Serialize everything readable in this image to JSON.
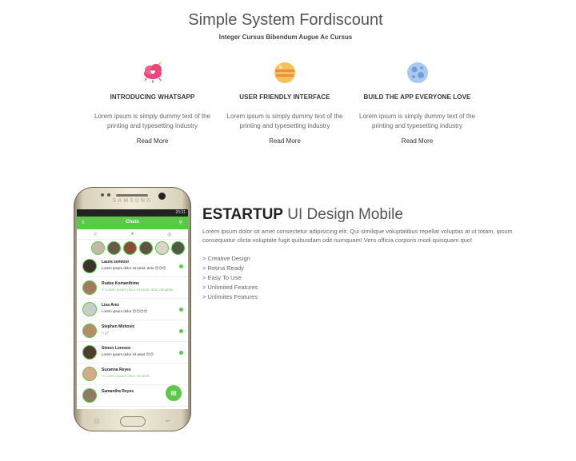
{
  "header": {
    "title": "Simple System Fordiscount",
    "subtitle": "Integer Cursus Bibendum Augue Ac Cursus"
  },
  "features": [
    {
      "icon": "cloud-heart-icon",
      "title": "INTRODUCING WHATSAPP",
      "text": "Lorem ipsum is simply dummy text of the printing and typesetting industry",
      "link": "Read More"
    },
    {
      "icon": "planet-icon",
      "title": "USER FRIENDLY INTERFACE",
      "text": "Lorem ipsum is simply dummy text of the printing and typesetting industry",
      "link": "Read More"
    },
    {
      "icon": "moon-icon",
      "title": "BUILD THE APP EVERYONE LOVE",
      "text": "Lorem ipsum is simply dummy text of the printing and typesetting industry",
      "link": "Read More"
    }
  ],
  "phone": {
    "brand": "SAMSUNG",
    "status_time": "20:31",
    "app_title": "Chats",
    "chats": [
      {
        "name": "Laura semioni",
        "message": "Lorem ipsum dolor sit amet, dolo 😊😊😊"
      },
      {
        "name": "Rudee Komanthime",
        "message": "✔ Lorem ipsum dolor sit amet, dolo voluptate"
      },
      {
        "name": "Lisa Arez",
        "message": "Lorem ipsum dolor 😊😊😊😊"
      },
      {
        "name": "Stephen Mirkovic",
        "message": "A gif"
      },
      {
        "name": "Simon Lorenzo",
        "message": "Lorem ipsum dolor sit amet 😊😊"
      },
      {
        "name": "Suzanna Reyes",
        "message": "✔ Lorem ipsum dolor sit amet"
      },
      {
        "name": "Samantha Reyes",
        "message": ""
      }
    ]
  },
  "product": {
    "title_bold": "ESTARTUP",
    "title_light": "UI Design Mobile",
    "description": "Lorem ipsum dolor sit amet consectetur adipisicing elit. Qui similique voluptatibus repellat voluptas at ut totam, ipsum consequatur clicta voluptate fugit quibusdam odit numquam! Vero officia corporis modi quisquam quo!",
    "bullets": [
      "> Creative Design",
      "> Retina Ready",
      "> Easy To Use",
      "> Unlimited Features",
      "> Unlimites Features"
    ]
  },
  "colors": {
    "accent": "#5cc84a",
    "feature_icon_1": "#e8457a",
    "feature_icon_2": "#f3b33d",
    "feature_icon_3": "#7fb0e0"
  }
}
